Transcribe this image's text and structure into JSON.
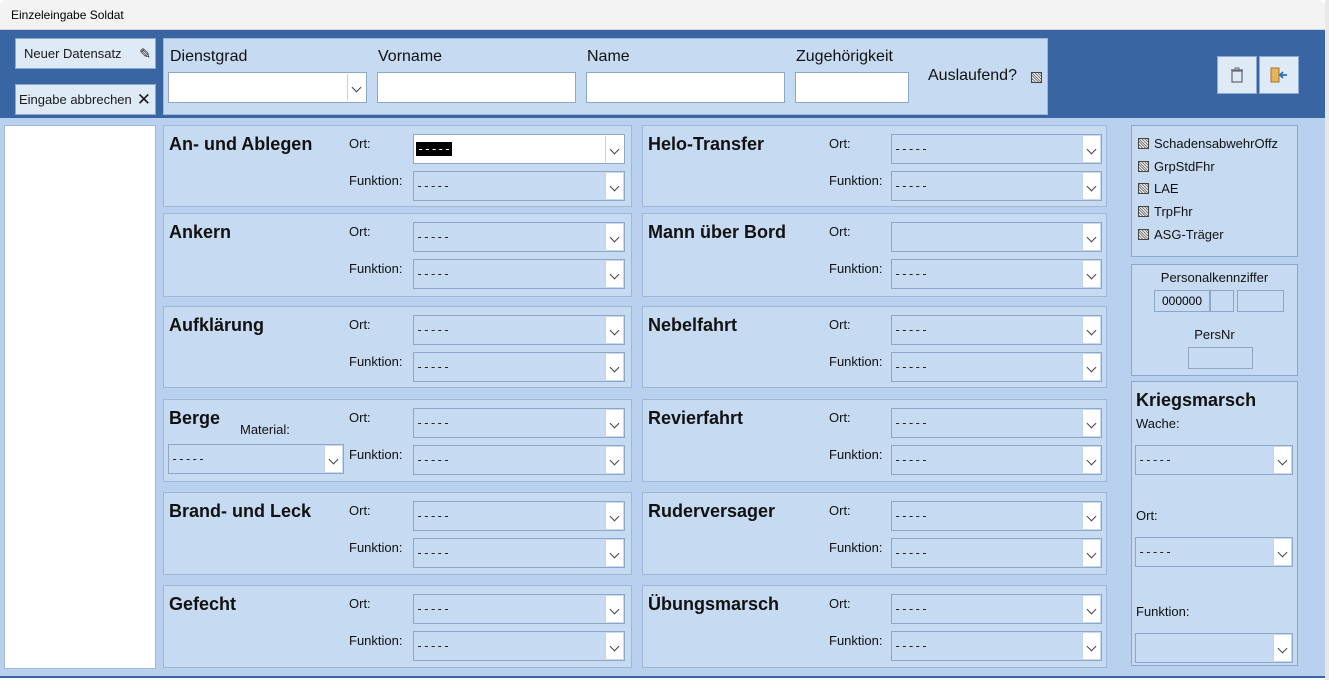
{
  "window": {
    "title": "Einzeleingabe Soldat"
  },
  "toolbar": {
    "new_record": "Neuer Datensatz",
    "cancel_entry": "Eingabe abbrechen",
    "new_icon": "pencil-icon",
    "cancel_icon": "x-icon",
    "delete_icon": "trash-icon",
    "exit_icon": "exit-door-icon"
  },
  "header": {
    "dienstgrad_label": "Dienstgrad",
    "vorname_label": "Vorname",
    "name_label": "Name",
    "zugehoerigkeit_label": "Zugehörigkeit",
    "auslaufend_label": "Auslaufend?",
    "dienstgrad_value": "",
    "vorname_value": "",
    "name_value": "",
    "zugehoerigkeit_value": ""
  },
  "labels": {
    "ort": "Ort:",
    "funktion": "Funktion:",
    "material": "Material:"
  },
  "sections": [
    {
      "title": "An- und Ablegen",
      "ort": "-----",
      "funktion": "-----"
    },
    {
      "title": "Ankern",
      "ort": "-----",
      "funktion": "-----"
    },
    {
      "title": "Aufklärung",
      "ort": "-----",
      "funktion": "-----"
    },
    {
      "title": "Berge",
      "ort": "-----",
      "funktion": "-----",
      "material": "-----"
    },
    {
      "title": "Brand- und Leck",
      "ort": "-----",
      "funktion": "-----"
    },
    {
      "title": "Gefecht",
      "ort": "-----",
      "funktion": "-----"
    },
    {
      "title": "Helo-Transfer",
      "ort": "-----",
      "funktion": "-----"
    },
    {
      "title": "Mann über Bord",
      "ort": "",
      "funktion": "-----"
    },
    {
      "title": "Nebelfahrt",
      "ort": "-----",
      "funktion": "-----"
    },
    {
      "title": "Revierfahrt",
      "ort": "-----",
      "funktion": "-----"
    },
    {
      "title": "Ruderversager",
      "ort": "-----",
      "funktion": "-----"
    },
    {
      "title": "Übungsmarsch",
      "ort": "-----",
      "funktion": "-----"
    }
  ],
  "checkboxes": [
    "SchadensabwehrOffz",
    "GrpStdFhr",
    "LAE",
    "TrpFhr",
    "ASG-Träger"
  ],
  "personal": {
    "title": "Personalkennziffer",
    "pk_value": "000000",
    "pk_part2": "",
    "pk_part3": "",
    "persnr_label": "PersNr",
    "persnr_value": ""
  },
  "kriegsmarsch": {
    "title": "Kriegsmarsch",
    "wache_label": "Wache:",
    "wache_value": "-----",
    "ort_label": "Ort:",
    "ort_value": "-----",
    "funktion_label": "Funktion:",
    "funktion_value": ""
  }
}
